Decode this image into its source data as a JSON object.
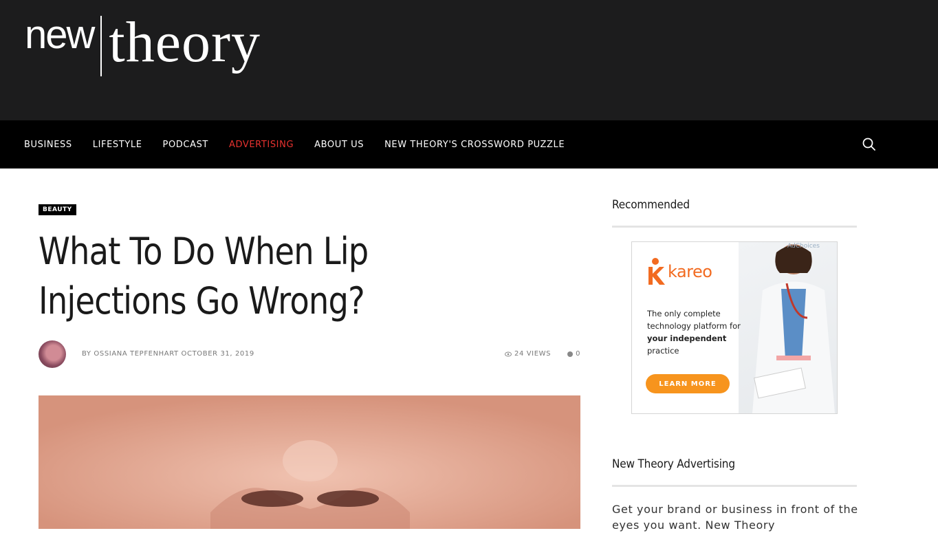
{
  "logo": {
    "part1": "new",
    "part2": "theory"
  },
  "nav": {
    "items": [
      {
        "label": "BUSINESS",
        "active": false
      },
      {
        "label": "LIFESTYLE",
        "active": false
      },
      {
        "label": "PODCAST",
        "active": false
      },
      {
        "label": "ADVERTISING",
        "active": true
      },
      {
        "label": "ABOUT US",
        "active": false
      },
      {
        "label": "NEW THEORY'S CROSSWORD PUZZLE",
        "active": false
      }
    ],
    "search_icon": "search-icon"
  },
  "article": {
    "category": "BEAUTY",
    "title": "What To Do When Lip Injections Go Wrong?",
    "byline": "BY OSSIANA TEPFENHART OCTOBER 31, 2019",
    "views": "24 VIEWS",
    "comments": "0"
  },
  "sidebar": {
    "recommended_heading": "Recommended",
    "ad": {
      "adchoices": "AdChoices",
      "brand": "kareo",
      "text_plain": "The only complete technology platform for",
      "text_bold": "your independent",
      "text_end": "practice",
      "button": "LEARN MORE"
    },
    "advertising_heading": "New Theory Advertising",
    "advertising_text": "Get your brand or business in front of the eyes you want. New Theory"
  },
  "colors": {
    "header_bg": "#1c1c1d",
    "nav_bg": "#000000",
    "active": "#e8322f",
    "ad_orange": "#f7941d"
  }
}
